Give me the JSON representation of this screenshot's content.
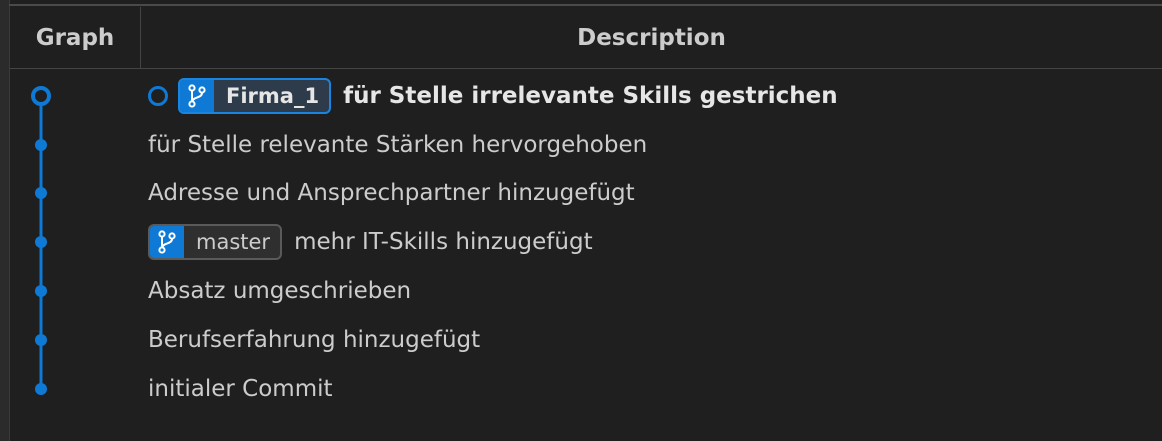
{
  "header": {
    "graph_label": "Graph",
    "description_label": "Description"
  },
  "colors": {
    "graph_line": "#0e7ad6",
    "badge_icon_bg": "#0e7ad6"
  },
  "commits": [
    {
      "message": "für Stelle irrelevante Skills gestrichen",
      "branch": "Firma_1",
      "head": true
    },
    {
      "message": "für Stelle relevante Stärken hervorgehoben"
    },
    {
      "message": "Adresse und Ansprechpartner hinzugefügt"
    },
    {
      "message": "mehr IT-Skills hinzugefügt",
      "branch": "master"
    },
    {
      "message": "Absatz umgeschrieben"
    },
    {
      "message": "Berufserfahrung hinzugefügt"
    },
    {
      "message": "initialer Commit"
    }
  ],
  "icons": {
    "branch": "git-branch-icon",
    "head_marker": "head-circle-icon"
  }
}
